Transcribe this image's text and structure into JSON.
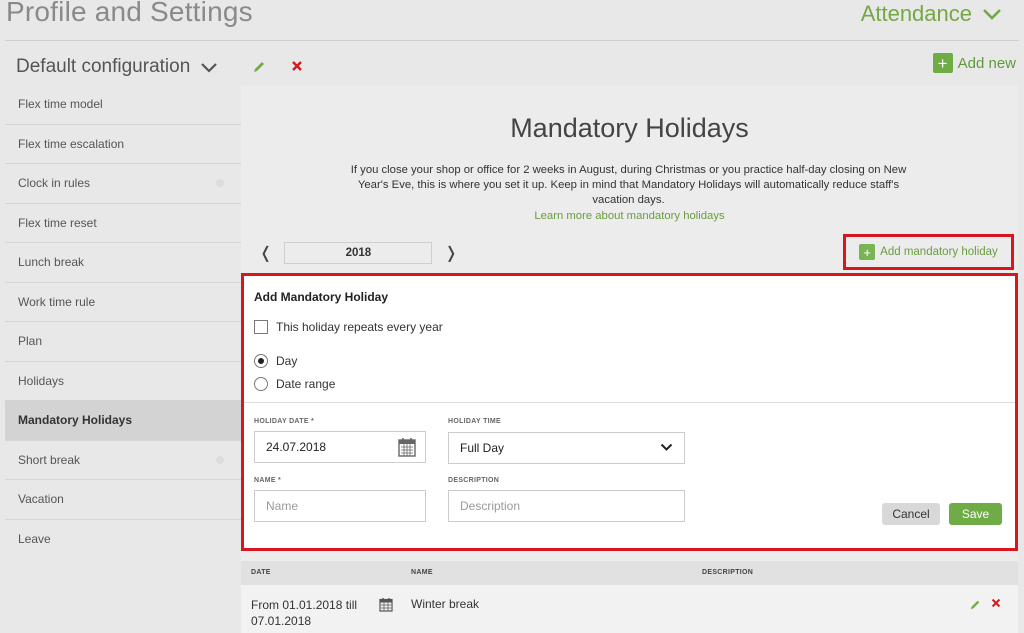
{
  "header": {
    "title": "Profile and Settings",
    "section_selector": "Attendance"
  },
  "toolbar": {
    "configuration": "Default configuration",
    "add_new": "Add new"
  },
  "sidebar": {
    "items": [
      {
        "label": "Flex time model"
      },
      {
        "label": "Flex time escalation"
      },
      {
        "label": "Clock in rules"
      },
      {
        "label": "Flex time reset"
      },
      {
        "label": "Lunch break"
      },
      {
        "label": "Work time rule"
      },
      {
        "label": "Plan"
      },
      {
        "label": "Holidays"
      },
      {
        "label": "Mandatory Holidays"
      },
      {
        "label": "Short break"
      },
      {
        "label": "Vacation"
      },
      {
        "label": "Leave"
      }
    ]
  },
  "main": {
    "title": "Mandatory Holidays",
    "description": "If you close your shop or office for 2 weeks in August, during Christmas or you practice half-day closing on New Year's Eve, this is where you set it up. Keep in mind that Mandatory Holidays will automatically reduce staff's vacation days.",
    "learn_more": "Learn more about mandatory holidays",
    "year": "2018",
    "add_holiday": "Add mandatory holiday"
  },
  "form": {
    "title": "Add Mandatory Holiday",
    "repeat_label": "This holiday repeats every year",
    "radio_day": "Day",
    "radio_range": "Date range",
    "date_label": "HOLIDAY DATE *",
    "date_value": "24.07.2018",
    "time_label": "HOLIDAY TIME",
    "time_value": "Full Day",
    "name_label": "NAME *",
    "name_placeholder": "Name",
    "desc_label": "DESCRIPTION",
    "desc_placeholder": "Description",
    "cancel": "Cancel",
    "save": "Save"
  },
  "table": {
    "headers": {
      "date": "DATE",
      "name": "NAME",
      "description": "DESCRIPTION"
    },
    "rows": [
      {
        "date": "From 01.01.2018 till 07.01.2018",
        "name": "Winter break",
        "description": ""
      }
    ]
  },
  "colors": {
    "accent_green": "#6fac46",
    "highlight_red": "#d6171d"
  }
}
